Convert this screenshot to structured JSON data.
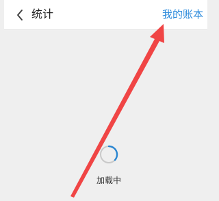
{
  "header": {
    "back_icon": "chevron-left-icon",
    "title": "统计",
    "account_link": "我的账本"
  },
  "main": {
    "loading_icon": "spinner-icon",
    "loading_text": "加载中"
  },
  "annotation": {
    "arrow_icon": "arrow-annotation-icon",
    "color": "#f04545"
  },
  "colors": {
    "accent": "#2d8bdc",
    "background": "#efefef",
    "header_background": "#ffffff",
    "spinner": "#2a86d1"
  }
}
